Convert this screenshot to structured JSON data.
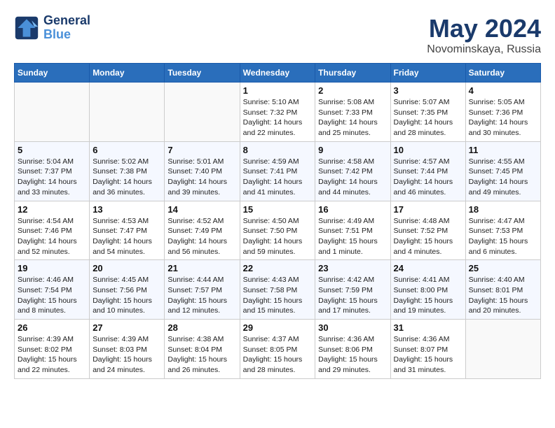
{
  "header": {
    "logo_line1": "General",
    "logo_line2": "Blue",
    "month_year": "May 2024",
    "location": "Novominskaya, Russia"
  },
  "weekdays": [
    "Sunday",
    "Monday",
    "Tuesday",
    "Wednesday",
    "Thursday",
    "Friday",
    "Saturday"
  ],
  "weeks": [
    [
      {
        "day": "",
        "sunrise": "",
        "sunset": "",
        "daylight": ""
      },
      {
        "day": "",
        "sunrise": "",
        "sunset": "",
        "daylight": ""
      },
      {
        "day": "",
        "sunrise": "",
        "sunset": "",
        "daylight": ""
      },
      {
        "day": "1",
        "sunrise": "Sunrise: 5:10 AM",
        "sunset": "Sunset: 7:32 PM",
        "daylight": "Daylight: 14 hours and 22 minutes."
      },
      {
        "day": "2",
        "sunrise": "Sunrise: 5:08 AM",
        "sunset": "Sunset: 7:33 PM",
        "daylight": "Daylight: 14 hours and 25 minutes."
      },
      {
        "day": "3",
        "sunrise": "Sunrise: 5:07 AM",
        "sunset": "Sunset: 7:35 PM",
        "daylight": "Daylight: 14 hours and 28 minutes."
      },
      {
        "day": "4",
        "sunrise": "Sunrise: 5:05 AM",
        "sunset": "Sunset: 7:36 PM",
        "daylight": "Daylight: 14 hours and 30 minutes."
      }
    ],
    [
      {
        "day": "5",
        "sunrise": "Sunrise: 5:04 AM",
        "sunset": "Sunset: 7:37 PM",
        "daylight": "Daylight: 14 hours and 33 minutes."
      },
      {
        "day": "6",
        "sunrise": "Sunrise: 5:02 AM",
        "sunset": "Sunset: 7:38 PM",
        "daylight": "Daylight: 14 hours and 36 minutes."
      },
      {
        "day": "7",
        "sunrise": "Sunrise: 5:01 AM",
        "sunset": "Sunset: 7:40 PM",
        "daylight": "Daylight: 14 hours and 39 minutes."
      },
      {
        "day": "8",
        "sunrise": "Sunrise: 4:59 AM",
        "sunset": "Sunset: 7:41 PM",
        "daylight": "Daylight: 14 hours and 41 minutes."
      },
      {
        "day": "9",
        "sunrise": "Sunrise: 4:58 AM",
        "sunset": "Sunset: 7:42 PM",
        "daylight": "Daylight: 14 hours and 44 minutes."
      },
      {
        "day": "10",
        "sunrise": "Sunrise: 4:57 AM",
        "sunset": "Sunset: 7:44 PM",
        "daylight": "Daylight: 14 hours and 46 minutes."
      },
      {
        "day": "11",
        "sunrise": "Sunrise: 4:55 AM",
        "sunset": "Sunset: 7:45 PM",
        "daylight": "Daylight: 14 hours and 49 minutes."
      }
    ],
    [
      {
        "day": "12",
        "sunrise": "Sunrise: 4:54 AM",
        "sunset": "Sunset: 7:46 PM",
        "daylight": "Daylight: 14 hours and 52 minutes."
      },
      {
        "day": "13",
        "sunrise": "Sunrise: 4:53 AM",
        "sunset": "Sunset: 7:47 PM",
        "daylight": "Daylight: 14 hours and 54 minutes."
      },
      {
        "day": "14",
        "sunrise": "Sunrise: 4:52 AM",
        "sunset": "Sunset: 7:49 PM",
        "daylight": "Daylight: 14 hours and 56 minutes."
      },
      {
        "day": "15",
        "sunrise": "Sunrise: 4:50 AM",
        "sunset": "Sunset: 7:50 PM",
        "daylight": "Daylight: 14 hours and 59 minutes."
      },
      {
        "day": "16",
        "sunrise": "Sunrise: 4:49 AM",
        "sunset": "Sunset: 7:51 PM",
        "daylight": "Daylight: 15 hours and 1 minute."
      },
      {
        "day": "17",
        "sunrise": "Sunrise: 4:48 AM",
        "sunset": "Sunset: 7:52 PM",
        "daylight": "Daylight: 15 hours and 4 minutes."
      },
      {
        "day": "18",
        "sunrise": "Sunrise: 4:47 AM",
        "sunset": "Sunset: 7:53 PM",
        "daylight": "Daylight: 15 hours and 6 minutes."
      }
    ],
    [
      {
        "day": "19",
        "sunrise": "Sunrise: 4:46 AM",
        "sunset": "Sunset: 7:54 PM",
        "daylight": "Daylight: 15 hours and 8 minutes."
      },
      {
        "day": "20",
        "sunrise": "Sunrise: 4:45 AM",
        "sunset": "Sunset: 7:56 PM",
        "daylight": "Daylight: 15 hours and 10 minutes."
      },
      {
        "day": "21",
        "sunrise": "Sunrise: 4:44 AM",
        "sunset": "Sunset: 7:57 PM",
        "daylight": "Daylight: 15 hours and 12 minutes."
      },
      {
        "day": "22",
        "sunrise": "Sunrise: 4:43 AM",
        "sunset": "Sunset: 7:58 PM",
        "daylight": "Daylight: 15 hours and 15 minutes."
      },
      {
        "day": "23",
        "sunrise": "Sunrise: 4:42 AM",
        "sunset": "Sunset: 7:59 PM",
        "daylight": "Daylight: 15 hours and 17 minutes."
      },
      {
        "day": "24",
        "sunrise": "Sunrise: 4:41 AM",
        "sunset": "Sunset: 8:00 PM",
        "daylight": "Daylight: 15 hours and 19 minutes."
      },
      {
        "day": "25",
        "sunrise": "Sunrise: 4:40 AM",
        "sunset": "Sunset: 8:01 PM",
        "daylight": "Daylight: 15 hours and 20 minutes."
      }
    ],
    [
      {
        "day": "26",
        "sunrise": "Sunrise: 4:39 AM",
        "sunset": "Sunset: 8:02 PM",
        "daylight": "Daylight: 15 hours and 22 minutes."
      },
      {
        "day": "27",
        "sunrise": "Sunrise: 4:39 AM",
        "sunset": "Sunset: 8:03 PM",
        "daylight": "Daylight: 15 hours and 24 minutes."
      },
      {
        "day": "28",
        "sunrise": "Sunrise: 4:38 AM",
        "sunset": "Sunset: 8:04 PM",
        "daylight": "Daylight: 15 hours and 26 minutes."
      },
      {
        "day": "29",
        "sunrise": "Sunrise: 4:37 AM",
        "sunset": "Sunset: 8:05 PM",
        "daylight": "Daylight: 15 hours and 28 minutes."
      },
      {
        "day": "30",
        "sunrise": "Sunrise: 4:36 AM",
        "sunset": "Sunset: 8:06 PM",
        "daylight": "Daylight: 15 hours and 29 minutes."
      },
      {
        "day": "31",
        "sunrise": "Sunrise: 4:36 AM",
        "sunset": "Sunset: 8:07 PM",
        "daylight": "Daylight: 15 hours and 31 minutes."
      },
      {
        "day": "",
        "sunrise": "",
        "sunset": "",
        "daylight": ""
      }
    ]
  ]
}
